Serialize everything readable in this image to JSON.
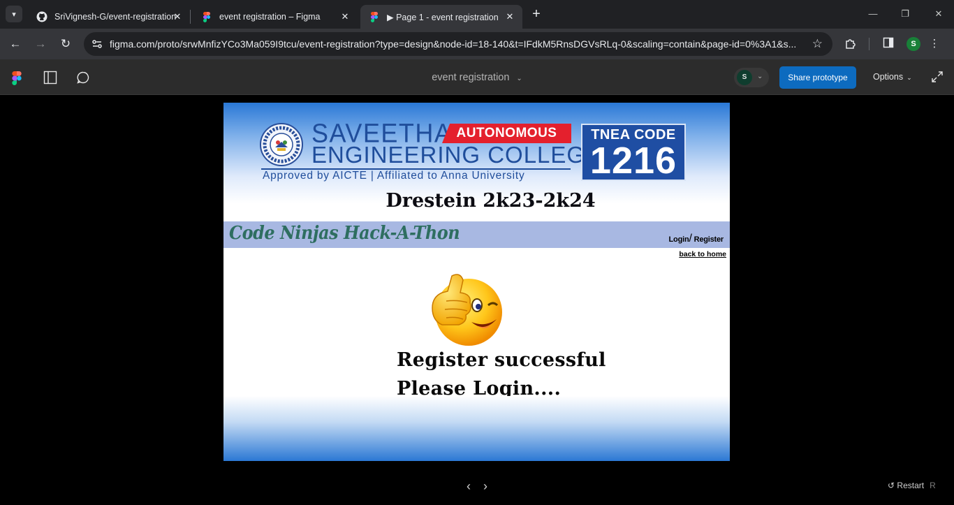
{
  "browser": {
    "tabs": [
      {
        "title": "SriVignesh-G/event-registration",
        "active": false
      },
      {
        "title": "event registration – Figma",
        "active": false
      },
      {
        "title": "▶ Page 1 - event registration",
        "active": true
      }
    ],
    "url": "figma.com/proto/srwMnfizYCo3Ma059I9tcu/event-registration?type=design&node-id=18-140&t=IFdkM5RnsDGVsRLq-0&scaling=contain&page-id=0%3A1&s...",
    "profile_initial": "S"
  },
  "figma": {
    "file_title": "event registration",
    "avatar_initial": "S",
    "share_label": "Share prototype",
    "options_label": "Options"
  },
  "frame": {
    "college_name_1": "SAVEETHA",
    "autonomous_label": "AUTONOMOUS",
    "college_name_2": "ENGINEERING COLLEGE",
    "approval_line": "Approved by AICTE  |  Affiliated to Anna University",
    "tnea_label": "TNEA CODE",
    "tnea_code": "1216",
    "event_title": "Drestein 2k23-2k24",
    "band_title": "Code Ninjas Hack-A-Thon",
    "login_label": "Login",
    "register_label": "Register",
    "back_home_label": "back to home",
    "message_line1": "Register successful",
    "message_line2": "Please Login...."
  },
  "footer": {
    "restart_label": "Restart",
    "restart_key": "R"
  },
  "colors": {
    "share_button": "#0d6bbf",
    "band": "#a8b8e2",
    "band_title": "#2e6e60",
    "autonomous_red": "#e4202d",
    "college_blue": "#1f4d9b"
  }
}
